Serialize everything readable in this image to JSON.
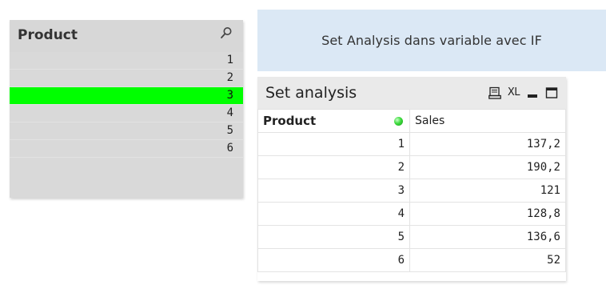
{
  "listbox": {
    "title": "Product",
    "search_icon": "search-icon",
    "items": [
      "1",
      "2",
      "3",
      "4",
      "5",
      "6"
    ],
    "selected": "3",
    "selected_color": "#00ff00"
  },
  "textbox": {
    "text": "Set Analysis dans variable avec IF",
    "background": "#dbe8f5"
  },
  "chart": {
    "title": "Set analysis",
    "caption_icons": {
      "print": "printer-icon",
      "excel_label": "XL",
      "minimize": "minimize-icon",
      "maximize": "maximize-icon"
    },
    "columns": [
      "Product",
      "Sales"
    ],
    "rows": [
      {
        "product": "1",
        "sales": "137,2"
      },
      {
        "product": "2",
        "sales": "190,2"
      },
      {
        "product": "3",
        "sales": "121"
      },
      {
        "product": "4",
        "sales": "128,8"
      },
      {
        "product": "5",
        "sales": "136,6"
      },
      {
        "product": "6",
        "sales": "52"
      }
    ]
  }
}
